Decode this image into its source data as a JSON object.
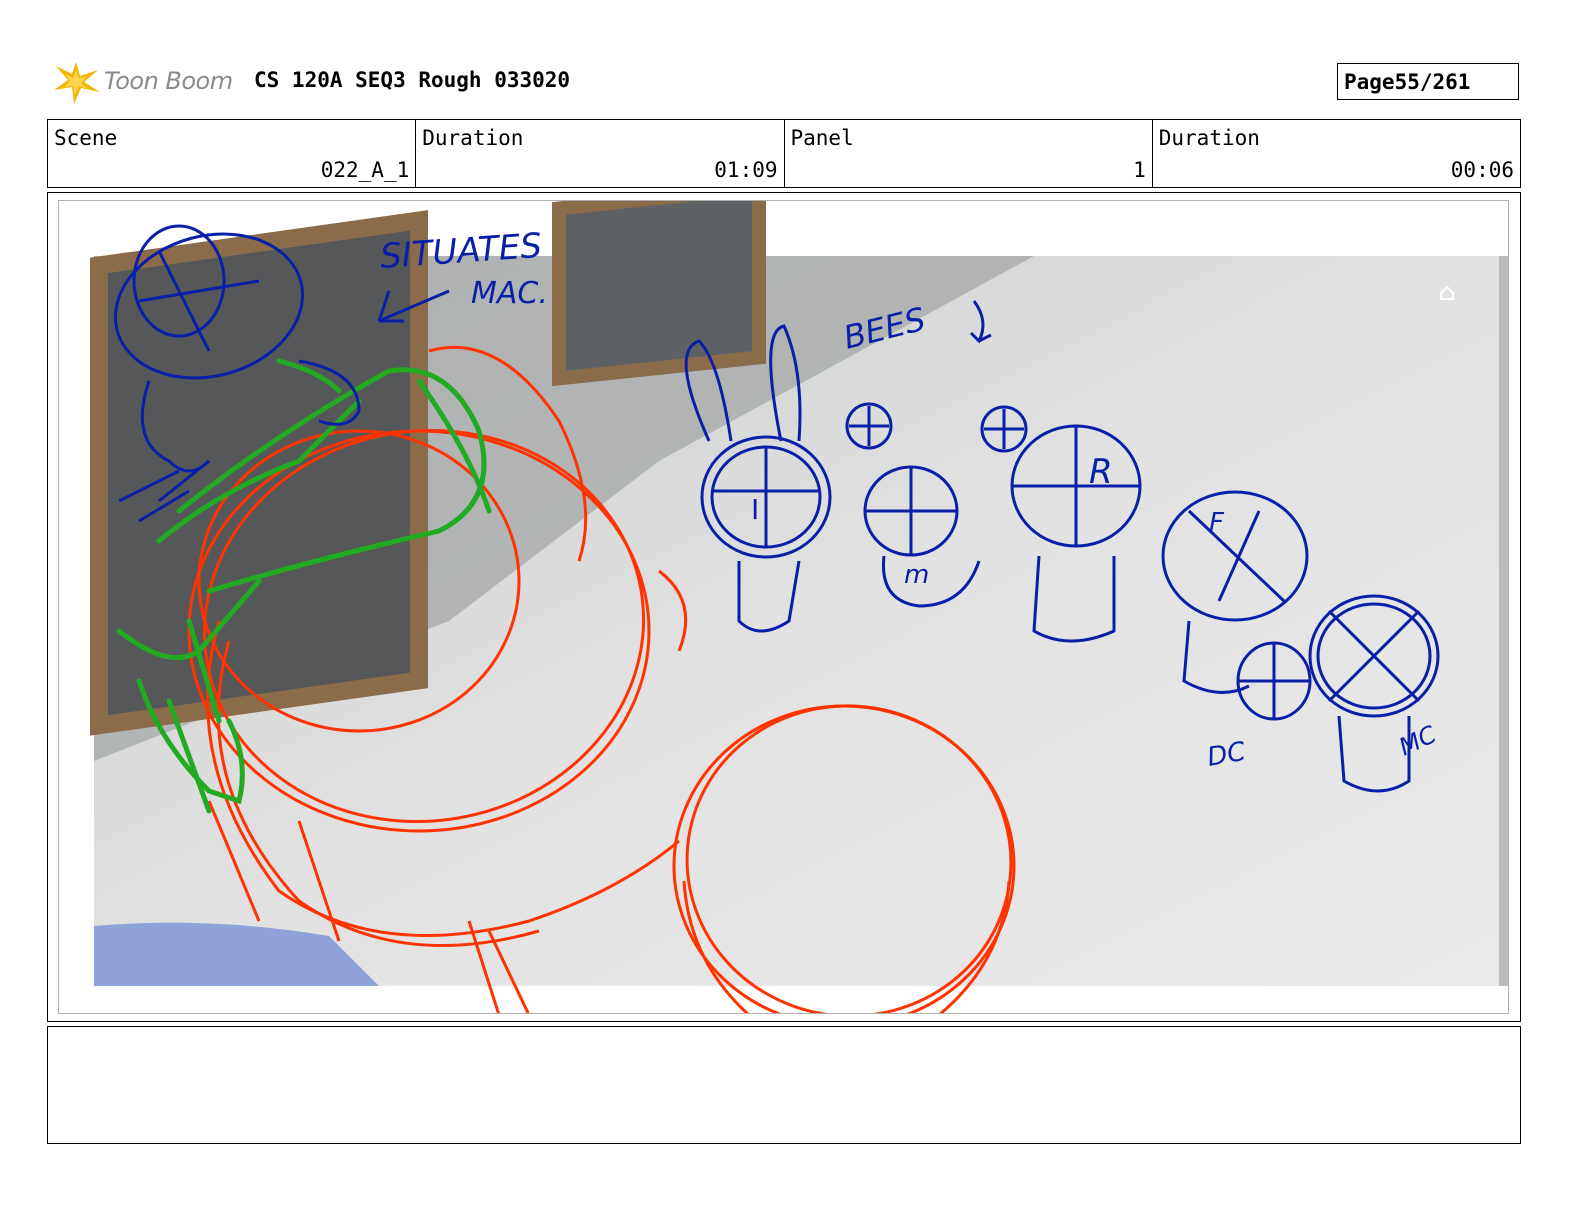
{
  "header": {
    "brand": "Toon Boom",
    "title": "CS 120A SEQ3 Rough 033020",
    "page_label": "Page",
    "page_value": "55/261"
  },
  "info": {
    "scene_label": "Scene",
    "scene_value": "022_A_1",
    "duration_label": "Duration",
    "duration_value": "01:09",
    "panel_label": "Panel",
    "panel_value": "1",
    "panel_duration_label": "Duration",
    "panel_duration_value": "00:06"
  },
  "sketch": {
    "note_situates": "SITUATES",
    "note_mac": "MAC.",
    "note_bees": "BEES",
    "char_i": "I",
    "char_m": "m",
    "char_r": "R",
    "char_f": "F",
    "char_dc": "DC",
    "char_mc": "MC",
    "colors": {
      "red": "#ff3300",
      "green": "#22aa22",
      "blue": "#0a1fa8",
      "floor": "#e4e4e4",
      "wall": "#6e7172"
    }
  },
  "notes": {
    "text": ""
  }
}
